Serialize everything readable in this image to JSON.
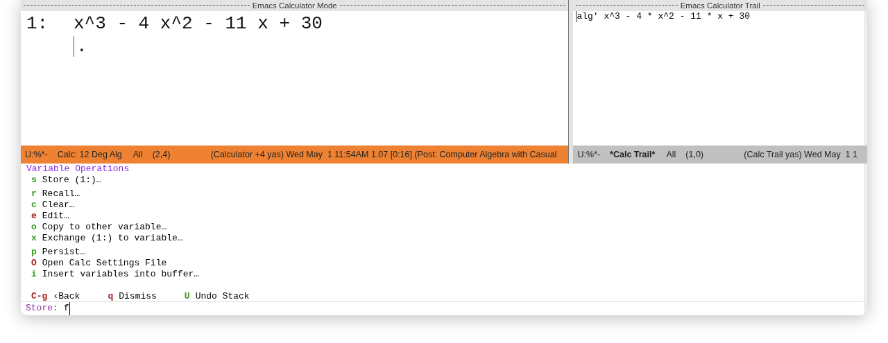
{
  "calc_pane": {
    "header": "Emacs Calculator Mode",
    "stack": [
      {
        "index": "1:",
        "expression": "x^3 - 4 x^2 - 11 x + 30"
      }
    ],
    "stack_end": "."
  },
  "trail_pane": {
    "header": "Emacs Calculator Trail",
    "lines": [
      "alg' x^3 - 4 * x^2 - 11 * x + 30"
    ]
  },
  "calc_mode_line": {
    "active": true,
    "segments": [
      {
        "text": "U:%*-",
        "bold": false
      },
      {
        "text": "Calc: 12 Deg Alg",
        "bold": false
      },
      {
        "text": "All",
        "bold": false
      },
      {
        "text": "(2,4)",
        "bold": false
      },
      {
        "text": "(Calculator +4 yas) Wed May  1 11:54AM 1.07 [0:16] (Post: Computer Algebra with Casual",
        "bold": false
      }
    ]
  },
  "trail_mode_line": {
    "active": false,
    "segments": [
      {
        "text": "U:%*-",
        "bold": false
      },
      {
        "text": "*Calc Trail*",
        "bold": true
      },
      {
        "text": "All",
        "bold": false
      },
      {
        "text": "(1,0)",
        "bold": false
      },
      {
        "text": "(Calc Trail yas) Wed May  1 1",
        "bold": false
      }
    ]
  },
  "menu": {
    "title": "Variable Operations",
    "groups": [
      [
        {
          "key": "s",
          "label": "Store (1:)…",
          "color": "#3a9a22"
        }
      ],
      [
        {
          "key": "r",
          "label": "Recall…",
          "color": "#3a9a22"
        },
        {
          "key": "c",
          "label": "Clear…",
          "color": "#3a9a22"
        },
        {
          "key": "e",
          "label": "Edit…",
          "color": "#a3201e"
        },
        {
          "key": "o",
          "label": "Copy to other variable…",
          "color": "#3a9a22"
        },
        {
          "key": "x",
          "label": "Exchange (1:) to variable…",
          "color": "#3a9a22"
        }
      ],
      [
        {
          "key": "p",
          "label": "Persist…",
          "color": "#3a9a22"
        },
        {
          "key": "O",
          "label": "Open Calc Settings File",
          "color": "#a3201e"
        },
        {
          "key": "i",
          "label": "Insert variables into buffer…",
          "color": "#3a9a22"
        }
      ]
    ],
    "footer": [
      {
        "key": "C-g",
        "label": "‹Back",
        "color": "#a3201e"
      },
      {
        "key": "q",
        "label": "Dismiss",
        "color": "#a3201e"
      },
      {
        "key": "U",
        "label": "Undo Stack",
        "color": "#3a9a22"
      }
    ]
  },
  "minibuffer": {
    "prompt": "Store:",
    "value": "f"
  }
}
